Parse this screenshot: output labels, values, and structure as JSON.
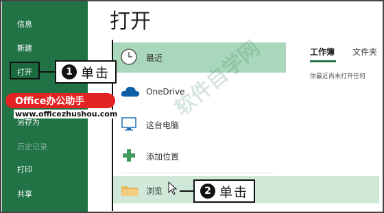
{
  "sidebar": {
    "items": [
      {
        "label": "信息"
      },
      {
        "label": "新建"
      },
      {
        "label": "打开"
      },
      {
        "label": "另存为"
      },
      {
        "label": "历史记录"
      },
      {
        "label": "打印"
      },
      {
        "label": "共享"
      }
    ]
  },
  "main": {
    "title": "打开",
    "locations": [
      {
        "label": "最近",
        "icon": "clock-icon"
      },
      {
        "label": "OneDrive",
        "icon": "cloud-icon"
      },
      {
        "label": "这台电脑",
        "icon": "computer-icon"
      },
      {
        "label": "添加位置",
        "icon": "plus-icon"
      },
      {
        "label": "浏览",
        "icon": "folder-icon"
      }
    ],
    "tabs": [
      {
        "label": "工作簿"
      },
      {
        "label": "文件夹"
      }
    ],
    "empty_message": "你最近尚未打开任何"
  },
  "annotations": {
    "step1": {
      "num": "1",
      "text": "单击"
    },
    "step2": {
      "num": "2",
      "text": "单击"
    }
  },
  "brand": {
    "name": "Office办公助手",
    "url": "www.officezhushou.com",
    "watermark": "软件自学网"
  },
  "colors": {
    "sidebar": "#217346",
    "selected": "#a9d7bb",
    "brand": "#e32222"
  }
}
